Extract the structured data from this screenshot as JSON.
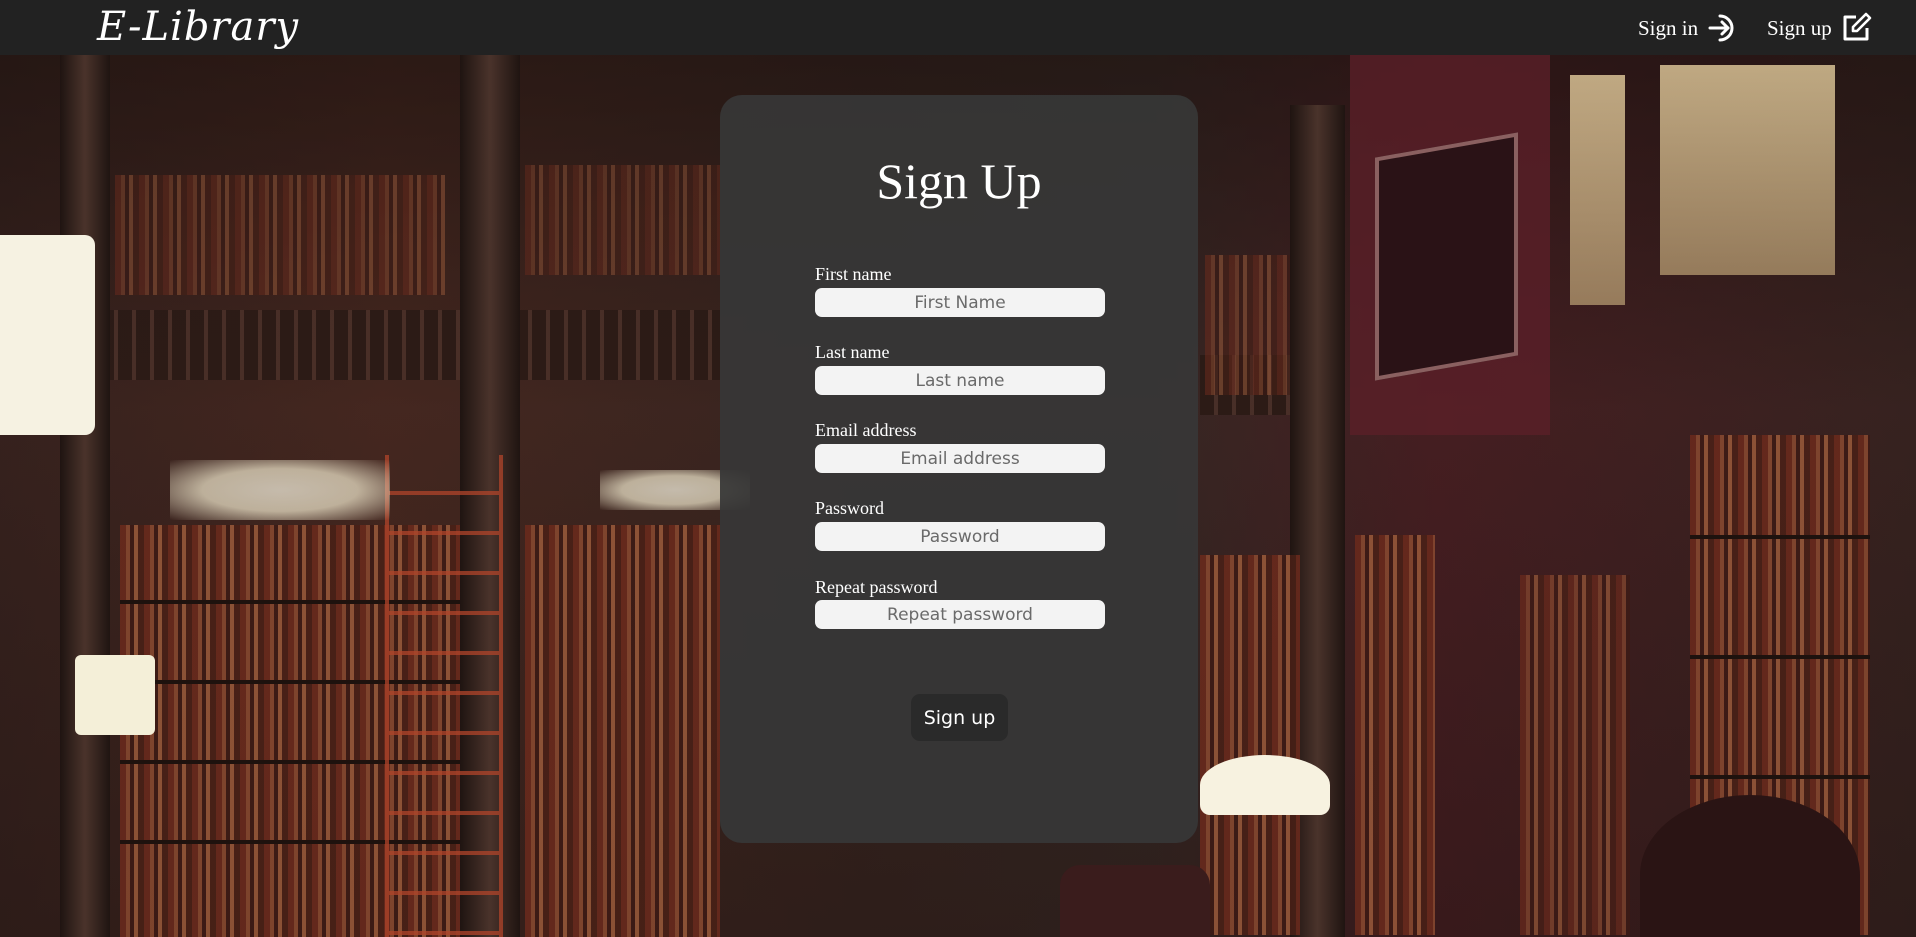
{
  "app": {
    "brand": "E-Library"
  },
  "nav": {
    "signin_label": "Sign in",
    "signin_icon": "sign-in-icon",
    "signup_label": "Sign up",
    "signup_icon": "edit-square-icon"
  },
  "form": {
    "title": "Sign Up",
    "fields": [
      {
        "label": "First name",
        "placeholder": "First Name",
        "value": ""
      },
      {
        "label": "Last name",
        "placeholder": "Last name",
        "value": ""
      },
      {
        "label": "Email address",
        "placeholder": "Email address",
        "value": ""
      },
      {
        "label": "Password",
        "placeholder": "Password",
        "value": ""
      },
      {
        "label": "Repeat password",
        "placeholder": "Repeat password",
        "value": ""
      }
    ],
    "submit_label": "Sign up"
  },
  "colors": {
    "navbar_bg": "#222222",
    "card_bg": "#373737",
    "button_bg": "#2a2a2a",
    "input_bg": "#f3f3f3"
  }
}
